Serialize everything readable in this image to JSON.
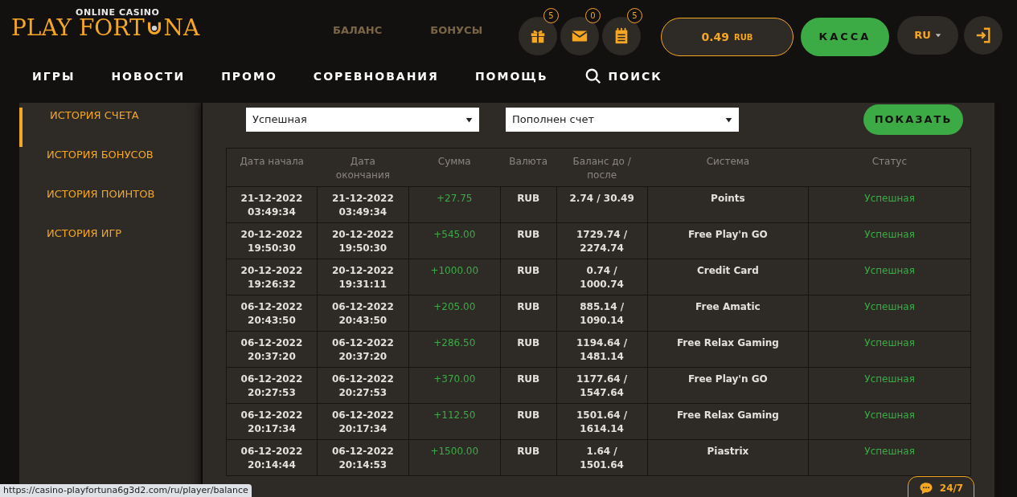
{
  "header": {
    "logo": {
      "tagline": "ONLINE CASINO",
      "name_left": "PLAY FORT",
      "name_right": "NA"
    },
    "notifications": [
      {
        "kind": "gift",
        "count": "5"
      },
      {
        "kind": "mail",
        "count": "0"
      },
      {
        "kind": "notes",
        "count": "5"
      }
    ],
    "balance": {
      "amount": "0.49",
      "currency": "RUB"
    },
    "cashier_button": "КАССА",
    "language": "RU",
    "nav": [
      {
        "label": "ИГРЫ",
        "kind": "link"
      },
      {
        "label": "НОВОСТИ",
        "kind": "link"
      },
      {
        "label": "ПРОМО",
        "kind": "link"
      },
      {
        "label": "СОРЕВНОВАНИЯ",
        "kind": "link"
      },
      {
        "label": "ПОМОЩЬ",
        "kind": "link"
      },
      {
        "label": "ПОИСК",
        "kind": "search"
      }
    ]
  },
  "account_tabs": [
    {
      "label": "БАЛАНС",
      "selected": false
    },
    {
      "label": "БОНУСЫ",
      "selected": false
    }
  ],
  "sidebar": {
    "items": [
      {
        "label": "ИСТОРИЯ СЧЕТА",
        "selected": true
      },
      {
        "label": "ИСТОРИЯ БОНУСОВ",
        "selected": false
      },
      {
        "label": "ИСТОРИЯ ПОИНТОВ",
        "selected": false
      },
      {
        "label": "ИСТОРИЯ ИГР",
        "selected": false
      }
    ]
  },
  "filters": [
    {
      "value": "Успешная"
    },
    {
      "value": "Пополнен счет"
    }
  ],
  "show_button": "ПОКАЗАТЬ",
  "table": {
    "columns": [
      "Дата начала",
      "Дата окончания",
      "Сумма",
      "Валюта",
      "Баланс до / после",
      "Система",
      "Статус"
    ],
    "rows": [
      [
        "21-12-2022 03:49:34",
        "21-12-2022 03:49:34",
        "+27.75",
        "RUB",
        "2.74 / 30.49",
        "Points",
        "Успешная"
      ],
      [
        "20-12-2022 19:50:30",
        "20-12-2022 19:50:30",
        "+545.00",
        "RUB",
        "1729.74 / 2274.74",
        "Free Play'n GO",
        "Успешная"
      ],
      [
        "20-12-2022 19:26:32",
        "20-12-2022 19:31:11",
        "+1000.00",
        "RUB",
        "0.74 / 1000.74",
        "Credit Card",
        "Успешная"
      ],
      [
        "06-12-2022 20:43:50",
        "06-12-2022 20:43:50",
        "+205.00",
        "RUB",
        "885.14 / 1090.14",
        "Free Amatic",
        "Успешная"
      ],
      [
        "06-12-2022 20:37:20",
        "06-12-2022 20:37:20",
        "+286.50",
        "RUB",
        "1194.64 / 1481.14",
        "Free Relax Gaming",
        "Успешная"
      ],
      [
        "06-12-2022 20:27:53",
        "06-12-2022 20:27:53",
        "+370.00",
        "RUB",
        "1177.64 / 1547.64",
        "Free Play'n GO",
        "Успешная"
      ],
      [
        "06-12-2022 20:17:34",
        "06-12-2022 20:17:34",
        "+112.50",
        "RUB",
        "1501.64 / 1614.14",
        "Free Relax Gaming",
        "Успешная"
      ],
      [
        "06-12-2022 20:14:44",
        "06-12-2022 20:14:53",
        "+1500.00",
        "RUB",
        "1.64 / 1501.64",
        "Piastrix",
        "Успешная"
      ]
    ]
  },
  "chat_button": "24/7",
  "status_bar": "https://casino-playfortuna6g3d2.com/ru/player/balance"
}
